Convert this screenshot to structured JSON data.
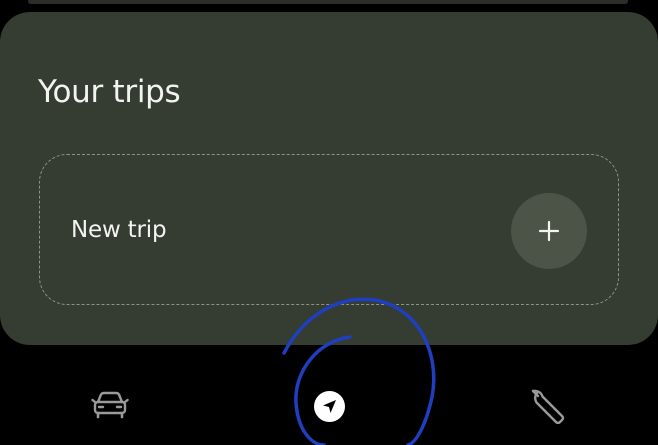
{
  "trips": {
    "title": "Your trips",
    "new_trip_label": "New trip",
    "add_icon": "plus-icon"
  },
  "bottom_nav": {
    "items": [
      {
        "icon": "car-icon",
        "active": false
      },
      {
        "icon": "navigation-arrow-icon",
        "active": true
      },
      {
        "icon": "wrench-icon",
        "active": false
      }
    ]
  },
  "colors": {
    "background": "#000000",
    "card": "#353c32",
    "dashed_border": "#8b9680",
    "add_button": "#4b5447",
    "text": "#f3f3f1",
    "nav_icon": "#9a9a9a",
    "annotation_stroke": "#1f3fc0"
  }
}
